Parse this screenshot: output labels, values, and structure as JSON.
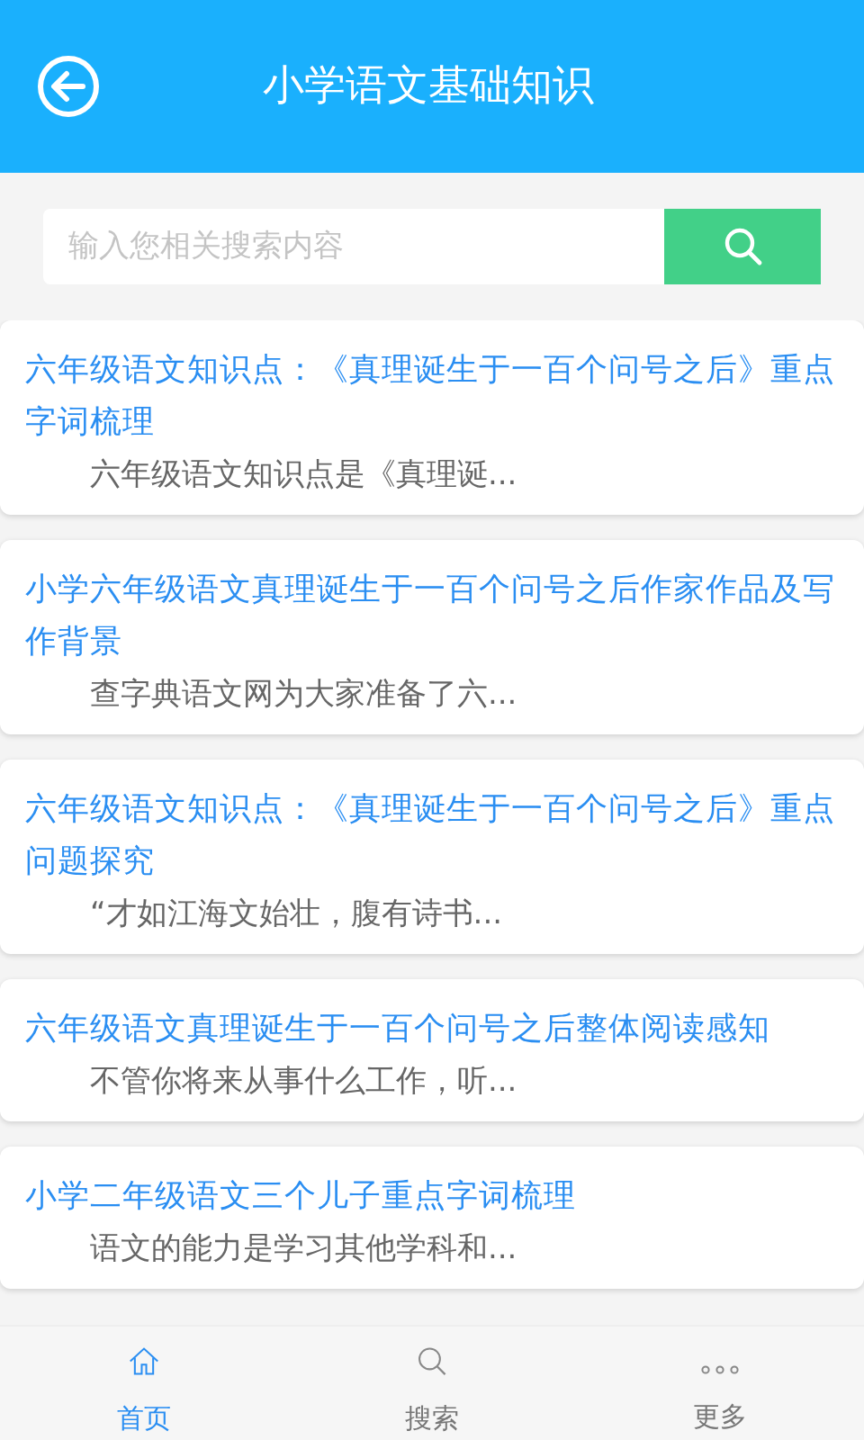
{
  "header": {
    "title": "小学语文基础知识"
  },
  "search": {
    "placeholder": "输入您相关搜索内容"
  },
  "articles": [
    {
      "title": "六年级语文知识点：《真理诞生于一百个问号之后》重点字词梳理",
      "snippet": "六年级语文知识点是《真理诞..."
    },
    {
      "title": "小学六年级语文真理诞生于一百个问号之后作家作品及写作背景",
      "snippet": "查字典语文网为大家准备了六..."
    },
    {
      "title": "六年级语文知识点：《真理诞生于一百个问号之后》重点问题探究",
      "snippet": "“才如江海文始壮，腹有诗书..."
    },
    {
      "title": "六年级语文真理诞生于一百个问号之后整体阅读感知",
      "snippet": "不管你将来从事什么工作，听..."
    },
    {
      "title": "小学二年级语文三个儿子重点字词梳理",
      "snippet": "语文的能力是学习其他学科和..."
    }
  ],
  "tabs": [
    {
      "kind": "home",
      "label": "首页",
      "selected": true
    },
    {
      "kind": "search",
      "label": "搜索",
      "selected": false
    },
    {
      "kind": "more",
      "label": "更多",
      "selected": false
    }
  ]
}
